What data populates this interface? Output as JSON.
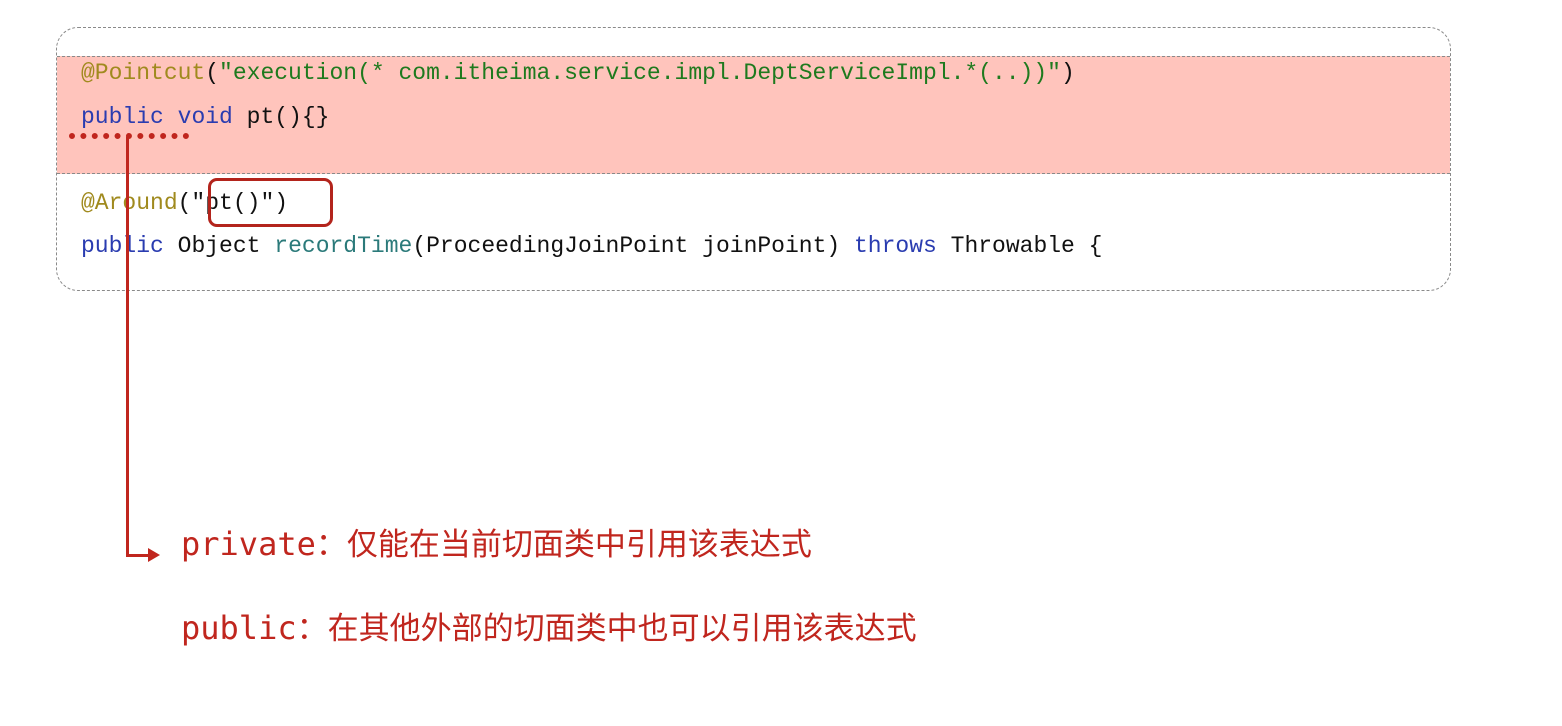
{
  "code": {
    "line1": {
      "annotation": "@Pointcut",
      "paren_open": "(",
      "string": "\"execution(* com.itheima.service.impl.DeptServiceImpl.*(..))\"",
      "paren_close": ")"
    },
    "line2": {
      "keyword_public": "public",
      "keyword_void": "void",
      "method": "pt(){}"
    },
    "line3": {
      "annotation": "@Around",
      "boxed_text": "(\"pt()\")"
    },
    "line4": {
      "keyword_public": "public",
      "type": "Object",
      "method": "recordTime",
      "params": "(ProceedingJoinPoint joinPoint)",
      "keyword_throws": "throws",
      "exception": "Throwable {"
    }
  },
  "notes": [
    {
      "modifier": "private",
      "separator": "：",
      "description": "仅能在当前切面类中引用该表达式"
    },
    {
      "modifier": "public",
      "separator": "：",
      "description": "在其他外部的切面类中也可以引用该表达式"
    }
  ],
  "colors": {
    "highlight_bg": "#ffc4bc",
    "annotation": "#a08a1e",
    "string": "#1e7a1e",
    "keyword": "#2a3cb0",
    "accent_red": "#c0261e"
  }
}
